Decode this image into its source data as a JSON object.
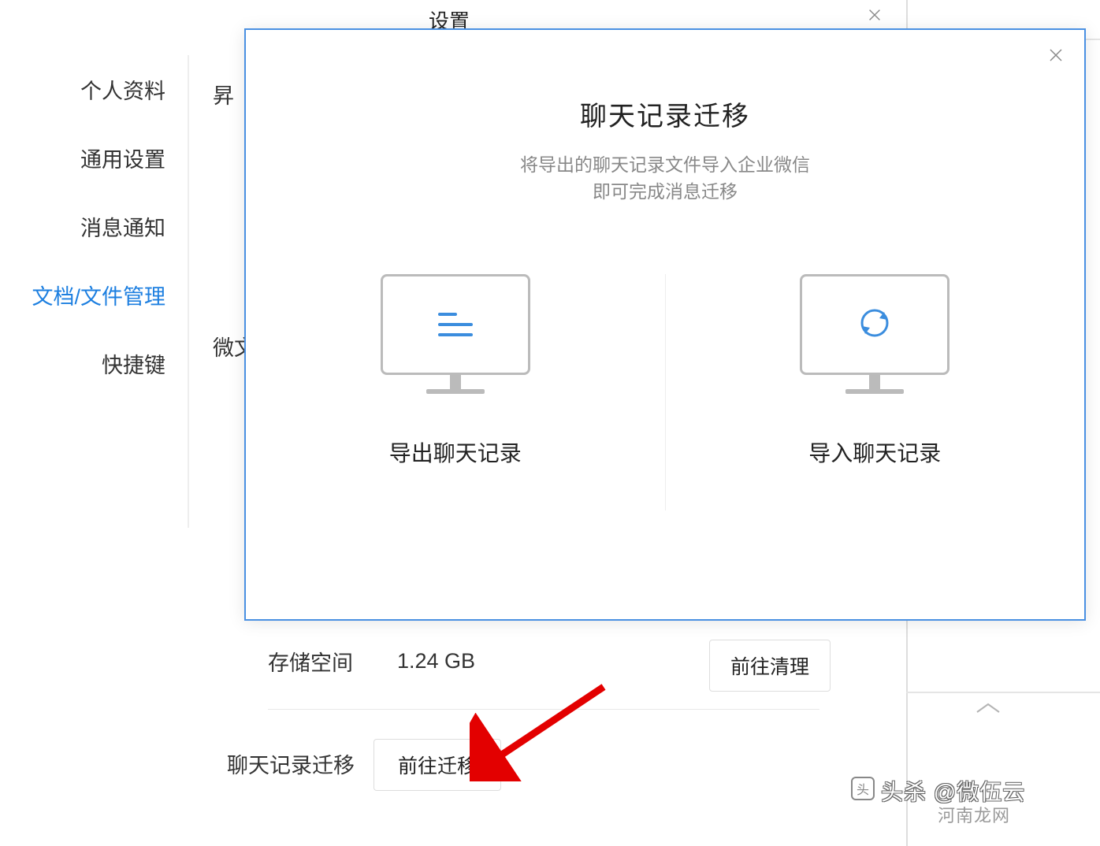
{
  "settings": {
    "title": "设置",
    "partial_label_top": "昇",
    "partial_label_mid": "微文"
  },
  "sidebar": {
    "items": [
      {
        "label": "个人资料"
      },
      {
        "label": "通用设置"
      },
      {
        "label": "消息通知"
      },
      {
        "label": "文档/文件管理"
      },
      {
        "label": "快捷键"
      }
    ]
  },
  "storage": {
    "label": "存储空间",
    "value": "1.24 GB",
    "button": "前往清理"
  },
  "migrate_row": {
    "label": "聊天记录迁移",
    "button": "前往迁移"
  },
  "modal": {
    "title": "聊天记录迁移",
    "subtitle1": "将导出的聊天记录文件导入企业微信",
    "subtitle2": "即可完成消息迁移",
    "export_label": "导出聊天记录",
    "import_label": "导入聊天记录"
  },
  "watermark": {
    "line1": "头杀 @微伍云",
    "line2": "河南龙网"
  }
}
